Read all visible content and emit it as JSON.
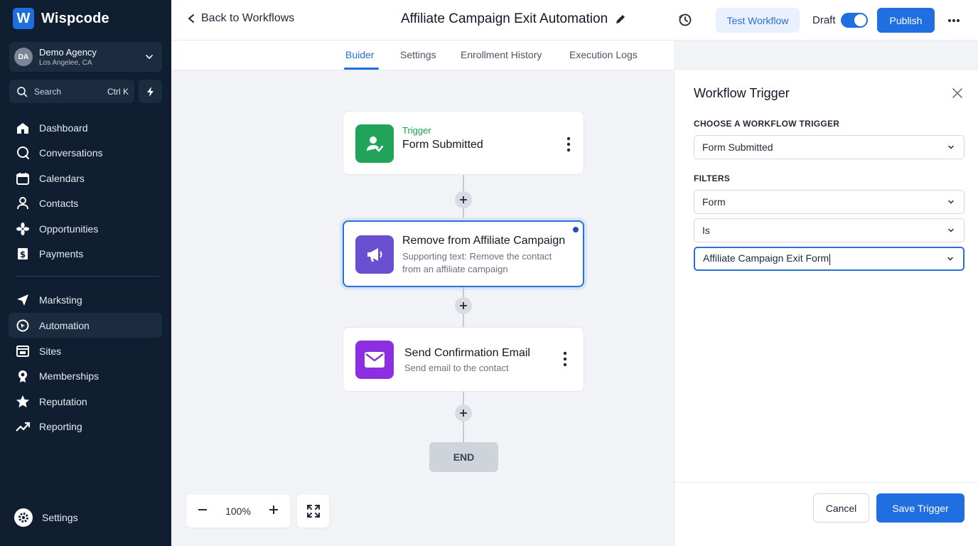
{
  "sidebar": {
    "brand": {
      "logo_letter": "W",
      "name": "Wispcode"
    },
    "account": {
      "initials": "DA",
      "name": "Demo Agency",
      "location": "Los Angelee, CA"
    },
    "search": {
      "label": "Search",
      "shortcut": "Ctrl K"
    },
    "nav_primary": [
      {
        "label": "Dashboard",
        "icon": "home-icon"
      },
      {
        "label": "Conversations",
        "icon": "chat-icon"
      },
      {
        "label": "Calendars",
        "icon": "calendar-icon"
      },
      {
        "label": "Contacts",
        "icon": "user-icon"
      },
      {
        "label": "Opportunities",
        "icon": "asterisk-icon"
      },
      {
        "label": "Payments",
        "icon": "dollar-icon"
      }
    ],
    "nav_secondary": [
      {
        "label": "Marksting",
        "icon": "send-icon"
      },
      {
        "label": "Automation",
        "icon": "automation-icon",
        "active": true
      },
      {
        "label": "Sites",
        "icon": "browser-icon"
      },
      {
        "label": "Memberships",
        "icon": "badge-icon"
      },
      {
        "label": "Reputation",
        "icon": "star-icon"
      },
      {
        "label": "Reporting",
        "icon": "trend-icon"
      }
    ],
    "settings_label": "Settings"
  },
  "topbar": {
    "back_label": "Back to Workflows",
    "workflow_title": "Affiliate Campaign Exit Automation",
    "test_label": "Test Workflow",
    "draft_label": "Draft",
    "draft_enabled": true,
    "publish_label": "Publish"
  },
  "tabs": [
    {
      "label": "Buider",
      "active": true
    },
    {
      "label": "Settings"
    },
    {
      "label": "Enrollment History"
    },
    {
      "label": "Execution Logs"
    }
  ],
  "canvas": {
    "trigger_node": {
      "eyebrow": "Trigger",
      "title": "Form Submitted"
    },
    "action_node": {
      "title": "Remove from Affiliate Campaign",
      "sub_line1": "Supporting text: Remove the contact",
      "sub_line2": "from an affiliate campaign"
    },
    "email_node": {
      "title": "Send Confirmation Email",
      "subtitle": "Send email to the contact"
    },
    "end_label": "END",
    "zoom_level": "100%"
  },
  "panel": {
    "title": "Workflow Trigger",
    "trigger_section_label": "CHOOSE A WORKFLOW TRIGGER",
    "trigger_value": "Form Submitted",
    "filters_label": "FILTERS",
    "filter_field": "Form",
    "filter_operator": "Is",
    "filter_value": "Affiliate Campaign Exit Form",
    "cancel_label": "Cancel",
    "save_label": "Save Trigger"
  },
  "colors": {
    "primary": "#1f6fe0",
    "sidebar_bg": "#0f1e31",
    "trigger_green": "#22a35a",
    "action_purple": "#6b4fd1",
    "email_purple": "#8b2fe0"
  }
}
